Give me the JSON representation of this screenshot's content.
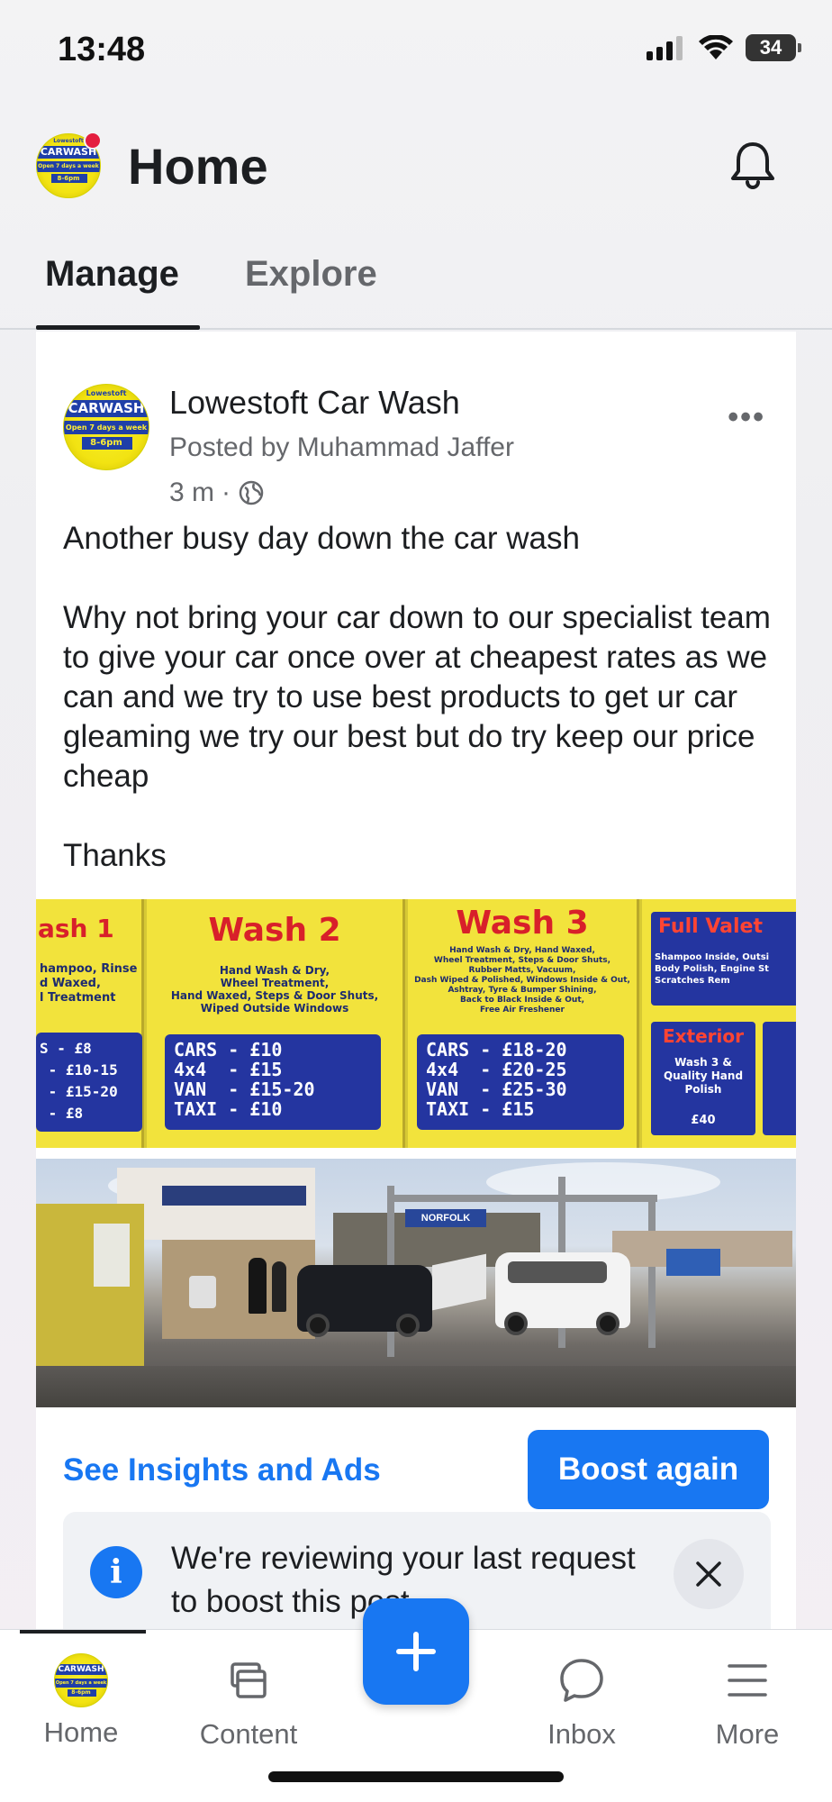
{
  "status_bar": {
    "time": "13:48",
    "battery": "34"
  },
  "header": {
    "title": "Home"
  },
  "tabs": [
    {
      "label": "Manage",
      "active": true
    },
    {
      "label": "Explore",
      "active": false
    }
  ],
  "post": {
    "page_name": "Lowestoft Car Wash",
    "posted_by": "Posted by Muhammad Jaffer",
    "time": "3 m",
    "separator": "·",
    "text": "Another busy day down the car wash\n\nWhy not bring your car down to our specialist team to give your car once over at cheapest rates as we can and we try to use best products to get ur car gleaming we try our best but do try keep our price cheap\n\nThanks"
  },
  "avatar_logo": {
    "top": "Lowestoft",
    "title": "CARWASH",
    "line1": "Open 7 days a week",
    "line2": "8-6pm"
  },
  "price_board": {
    "wash1": {
      "title": "ash 1",
      "desc": "hampoo, Rinse\nd Waxed,\nl Treatment",
      "prices": "S - £8\n - £10-15\n - £15-20\n - £8"
    },
    "wash2": {
      "title": "Wash 2",
      "desc": "Hand Wash & Dry,\nWheel Treatment,\nHand Waxed, Steps & Door Shuts,\nWiped Outside Windows",
      "prices": "CARS - £10\n4x4  - £15\nVAN  - £15-20\nTAXI - £10"
    },
    "wash3": {
      "title": "Wash 3",
      "desc": "Hand Wash & Dry, Hand Waxed,\nWheel Treatment, Steps & Door Shuts,\nRubber Matts, Vacuum,\nDash Wiped & Polished, Windows Inside & Out,\nAshtray, Tyre & Bumper Shining,\nBack to Black Inside & Out,\nFree Air Freshener",
      "prices": "CARS - £18-20\n4x4  - £20-25\nVAN  - £25-30\nTAXI - £15"
    },
    "full_valet": {
      "title": "Full Valet",
      "desc": "Shampoo Inside, Outsi\nBody Polish, Engine St\nScratches Rem"
    },
    "exterior": {
      "title": "Exterior",
      "desc": "Wash 3 &\nQuality Hand\nPolish",
      "price": "£40"
    }
  },
  "photo": {
    "ship_label": "NORFOLK"
  },
  "actions": {
    "insights": "See Insights and Ads",
    "boost": "Boost again",
    "review_text": "We're reviewing your last request to boost this post"
  },
  "bottom_nav": [
    {
      "label": "Home",
      "active": true
    },
    {
      "label": "Content",
      "active": false
    },
    {
      "label": "Inbox",
      "active": false
    },
    {
      "label": "More",
      "active": false
    }
  ],
  "colors": {
    "accent": "#1877f2",
    "notification": "#e41e3f",
    "board_yellow": "#f2e33c",
    "board_blue": "#2435a0",
    "board_red": "#d8202a"
  }
}
